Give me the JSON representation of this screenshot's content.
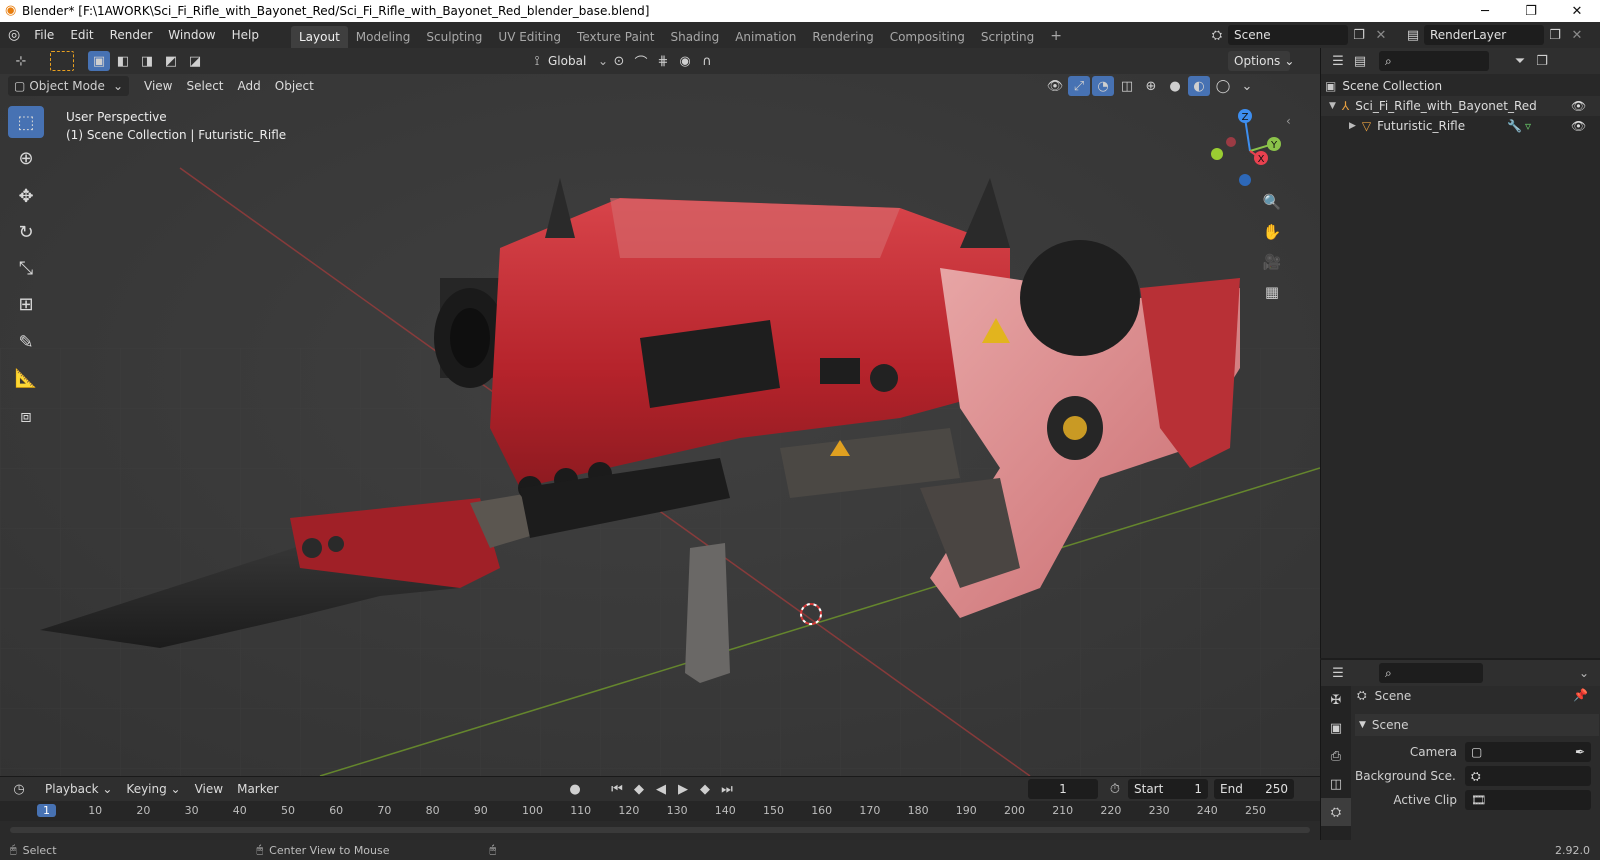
{
  "window": {
    "title": "Blender* [F:\\1AWORK\\Sci_Fi_Rifle_with_Bayonet_Red/Sci_Fi_Rifle_with_Bayonet_Red_blender_base.blend]",
    "min_glyph": "─",
    "max_glyph": "❐",
    "close_glyph": "✕"
  },
  "menu": {
    "items": [
      "File",
      "Edit",
      "Render",
      "Window",
      "Help"
    ]
  },
  "workspaces": {
    "tabs": [
      "Layout",
      "Modeling",
      "Sculpting",
      "UV Editing",
      "Texture Paint",
      "Shading",
      "Animation",
      "Rendering",
      "Compositing",
      "Scripting"
    ],
    "active": "Layout",
    "add_glyph": "+"
  },
  "scene_selector": {
    "value": "Scene"
  },
  "renderlayer_selector": {
    "value": "RenderLayer"
  },
  "viewport_header": {
    "orientation": "Global",
    "options_label": "Options"
  },
  "viewport_menu": {
    "mode": "Object Mode",
    "items": [
      "View",
      "Select",
      "Add",
      "Object"
    ]
  },
  "overlay_text": {
    "line1": "User Perspective",
    "line2": "(1) Scene Collection | Futuristic_Rifle"
  },
  "gizmo": {
    "x": "X",
    "y": "Y",
    "z": "Z"
  },
  "outliner": {
    "root": "Scene Collection",
    "collection": "Sci_Fi_Rifle_with_Bayonet_Red",
    "object": "Futuristic_Rifle"
  },
  "properties": {
    "breadcrumb": "Scene",
    "panel_title": "Scene",
    "fields": [
      {
        "label": "Camera",
        "value": ""
      },
      {
        "label": "Background Sce...",
        "value": ""
      },
      {
        "label": "Active Clip",
        "value": ""
      }
    ]
  },
  "timeline": {
    "menu": [
      "Playback",
      "Keying",
      "View",
      "Marker"
    ],
    "current_frame": "1",
    "start_label": "Start",
    "start_value": "1",
    "end_label": "End",
    "end_value": "250",
    "ruler": [
      "1",
      "10",
      "20",
      "30",
      "40",
      "50",
      "60",
      "70",
      "80",
      "90",
      "100",
      "110",
      "120",
      "130",
      "140",
      "150",
      "160",
      "170",
      "180",
      "190",
      "200",
      "210",
      "220",
      "230",
      "240",
      "250"
    ]
  },
  "statusbar": {
    "left": "Select",
    "middle": "Center View to Mouse",
    "version": "2.92.0"
  },
  "colors": {
    "accent": "#4772b3",
    "rifle_red": "#c0282b",
    "axis_x": "#e8414f",
    "axis_y": "#8bc34a",
    "axis_z": "#3d8ef0"
  }
}
